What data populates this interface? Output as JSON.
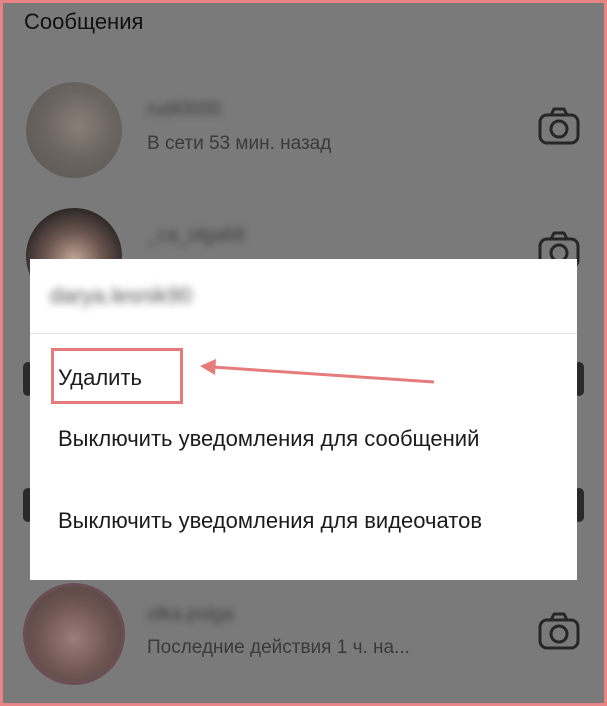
{
  "header": {
    "title": "Сообщения"
  },
  "conversations": [
    {
      "username": "rudi0000",
      "status": "В сети 53 мин. назад",
      "icon": "camera-icon"
    },
    {
      "username": "_ca_olga66",
      "status": "",
      "icon": "camera-icon"
    },
    {
      "username": "olka.polga",
      "status": "Последние действия 1 ч. на...",
      "icon": "camera-icon"
    }
  ],
  "dialog": {
    "title": "darya.lesnik90",
    "options": [
      "Удалить",
      "Выключить уведомления для сообщений",
      "Выключить уведомления для видеочатов"
    ]
  },
  "annotation": {
    "highlight_color": "#e57b7b",
    "frame_color": "#e88484"
  }
}
